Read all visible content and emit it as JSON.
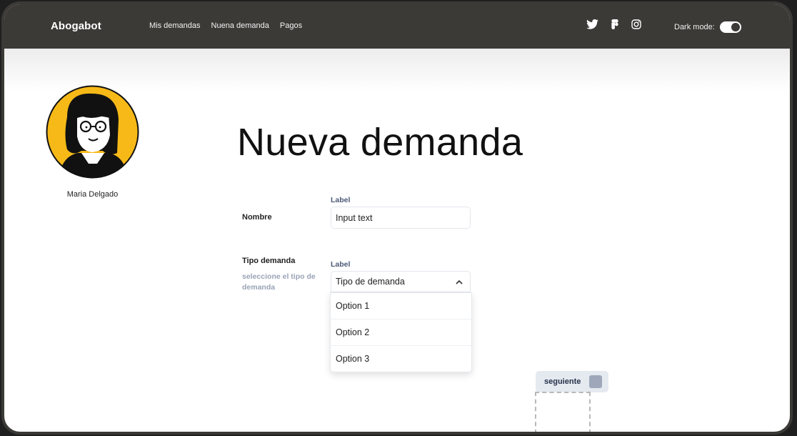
{
  "app": {
    "brand": "Abogabot"
  },
  "nav": {
    "items": [
      "Mis demandas",
      "Nuena demanda",
      "Pagos"
    ]
  },
  "social": {
    "icons": [
      "twitter-icon",
      "figma-icon",
      "instagram-icon"
    ]
  },
  "dark_mode": {
    "label": "Dark mode:",
    "enabled": true
  },
  "user": {
    "name": "Maria Delgado"
  },
  "page": {
    "title": "Nueva demanda"
  },
  "form": {
    "nombre": {
      "row_label": "Nombre",
      "field_label": "Label",
      "value": "Input text"
    },
    "tipo": {
      "row_label": "Tipo demanda",
      "help": "seleccione el tipo de demanda",
      "field_label": "Label",
      "selected": "Tipo de demanda",
      "options": [
        "Option 1",
        "Option 2",
        "Option 3"
      ]
    }
  },
  "actions": {
    "next_label": "seguiente"
  },
  "colors": {
    "topbar": "#3b3a37",
    "avatar_bg": "#f6b917",
    "button_bg": "#e5e9f0",
    "label_blue": "#4b5a78"
  }
}
